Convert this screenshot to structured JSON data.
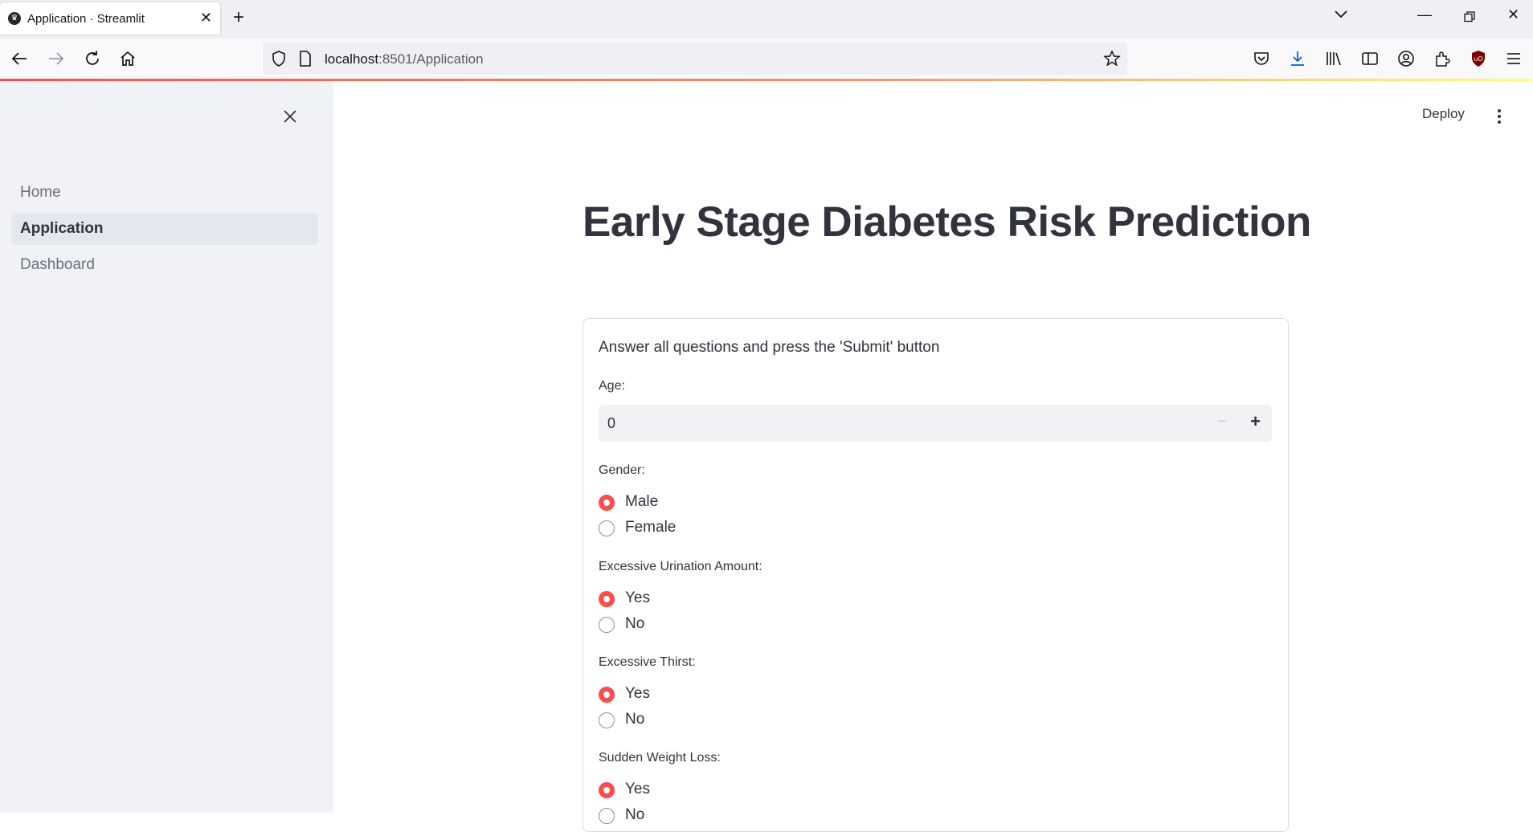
{
  "browser": {
    "tab_title": "Application · Streamlit",
    "url_host": "localhost",
    "url_rest": ":8501/Application"
  },
  "sidebar": {
    "items": [
      {
        "label": "Home"
      },
      {
        "label": "Application"
      },
      {
        "label": "Dashboard"
      }
    ]
  },
  "header": {
    "deploy_label": "Deploy"
  },
  "main": {
    "title": "Early Stage Diabetes Risk Prediction",
    "form": {
      "intro": "Answer all questions and press the 'Submit' button",
      "age": {
        "label": "Age:",
        "value": "0",
        "minus": "−",
        "plus": "+"
      },
      "gender": {
        "label": "Gender:",
        "options": [
          "Male",
          "Female"
        ],
        "selected": "Male"
      },
      "urination": {
        "label": "Excessive Urination Amount:",
        "options": [
          "Yes",
          "No"
        ],
        "selected": "Yes"
      },
      "thirst": {
        "label": "Excessive Thirst:",
        "options": [
          "Yes",
          "No"
        ],
        "selected": "Yes"
      },
      "weight_loss": {
        "label": "Sudden Weight Loss:",
        "options": [
          "Yes",
          "No"
        ],
        "selected": "Yes"
      }
    }
  },
  "colors": {
    "accent": "#ff4b4b",
    "sidebar_bg": "#f0f2f6",
    "text": "#31333f"
  }
}
